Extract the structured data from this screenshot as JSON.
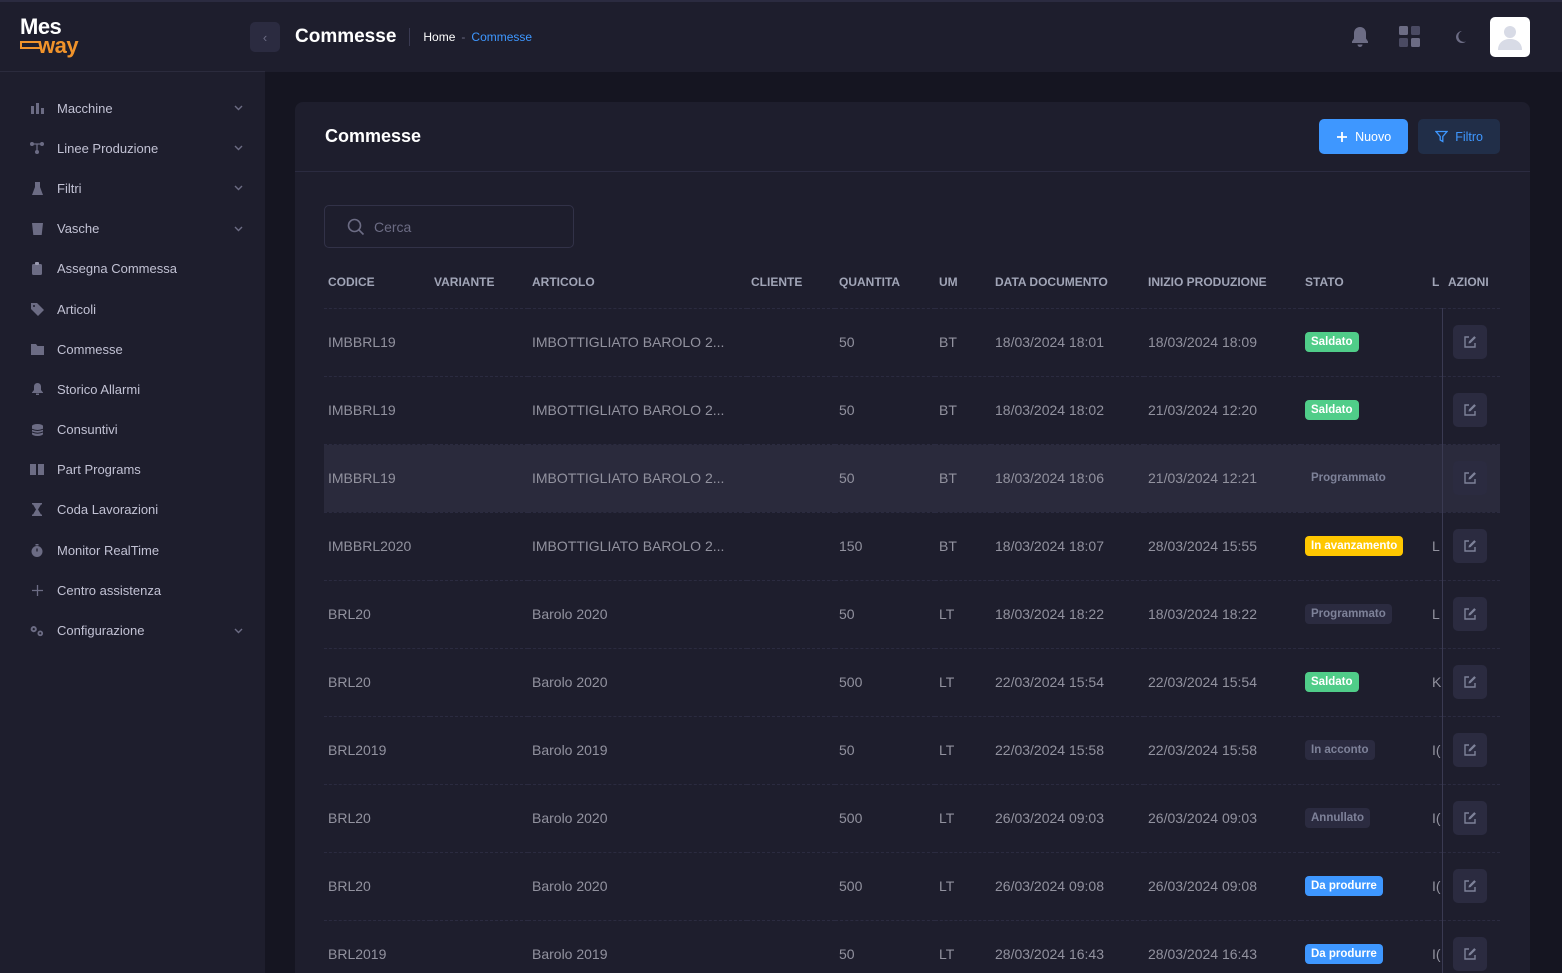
{
  "app": {
    "logo_top": "Mes",
    "logo_bottom": "way"
  },
  "sidebar": {
    "items": [
      {
        "label": "Macchine",
        "icon": "bar-chart-icon",
        "has_submenu": true
      },
      {
        "label": "Linee Produzione",
        "icon": "network-icon",
        "has_submenu": true
      },
      {
        "label": "Filtri",
        "icon": "flask-icon",
        "has_submenu": true
      },
      {
        "label": "Vasche",
        "icon": "bucket-icon",
        "has_submenu": true
      },
      {
        "label": "Assegna Commessa",
        "icon": "clipboard-icon",
        "has_submenu": false
      },
      {
        "label": "Articoli",
        "icon": "tag-icon",
        "has_submenu": false
      },
      {
        "label": "Commesse",
        "icon": "folder-icon",
        "has_submenu": false
      },
      {
        "label": "Storico Allarmi",
        "icon": "bell-icon",
        "has_submenu": false
      },
      {
        "label": "Consuntivi",
        "icon": "database-icon",
        "has_submenu": false
      },
      {
        "label": "Part Programs",
        "icon": "book-icon",
        "has_submenu": false
      },
      {
        "label": "Coda Lavorazioni",
        "icon": "hourglass-icon",
        "has_submenu": false
      },
      {
        "label": "Monitor RealTime",
        "icon": "stopwatch-icon",
        "has_submenu": false
      },
      {
        "label": "Centro assistenza",
        "icon": "plus-icon",
        "has_submenu": false
      },
      {
        "label": "Configurazione",
        "icon": "gears-icon",
        "has_submenu": true
      }
    ]
  },
  "header": {
    "title": "Commesse",
    "breadcrumb_home": "Home",
    "breadcrumb_separator": "-",
    "breadcrumb_current": "Commesse"
  },
  "card": {
    "title": "Commesse",
    "new_label": "Nuovo",
    "filter_label": "Filtro"
  },
  "search": {
    "placeholder": "Cerca"
  },
  "table": {
    "columns": [
      "CODICE",
      "VARIANTE",
      "ARTICOLO",
      "CLIENTE",
      "QUANTITA",
      "UM",
      "DATA DOCUMENTO",
      "INIZIO PRODUZIONE",
      "STATO",
      "L",
      "AZIONI"
    ],
    "rows": [
      {
        "codice": "IMBBRL19",
        "variante": "",
        "articolo": "IMBOTTIGLIATO BAROLO 2...",
        "cliente": "",
        "quantita": "50",
        "um": "BT",
        "data_documento": "18/03/2024 18:01",
        "inizio_produzione": "18/03/2024 18:09",
        "stato": "Saldato",
        "stato_color": "#50cd89",
        "l": ""
      },
      {
        "codice": "IMBBRL19",
        "variante": "",
        "articolo": "IMBOTTIGLIATO BAROLO 2...",
        "cliente": "",
        "quantita": "50",
        "um": "BT",
        "data_documento": "18/03/2024 18:02",
        "inizio_produzione": "21/03/2024 12:20",
        "stato": "Saldato",
        "stato_color": "#50cd89",
        "l": ""
      },
      {
        "codice": "IMBBRL19",
        "variante": "",
        "articolo": "IMBOTTIGLIATO BAROLO 2...",
        "cliente": "",
        "quantita": "50",
        "um": "BT",
        "data_documento": "18/03/2024 18:06",
        "inizio_produzione": "21/03/2024 12:21",
        "stato": "Programmato",
        "stato_color": "#2b2b40",
        "l": "",
        "highlight": true
      },
      {
        "codice": "IMBBRL2020",
        "variante": "",
        "articolo": "IMBOTTIGLIATO BAROLO 2...",
        "cliente": "",
        "quantita": "150",
        "um": "BT",
        "data_documento": "18/03/2024 18:07",
        "inizio_produzione": "28/03/2024 15:55",
        "stato": "In avanzamento",
        "stato_color": "#ffc700",
        "l": "L"
      },
      {
        "codice": "BRL20",
        "variante": "",
        "articolo": "Barolo 2020",
        "cliente": "",
        "quantita": "50",
        "um": "LT",
        "data_documento": "18/03/2024 18:22",
        "inizio_produzione": "18/03/2024 18:22",
        "stato": "Programmato",
        "stato_color": "#2b2b40",
        "l": "L"
      },
      {
        "codice": "BRL20",
        "variante": "",
        "articolo": "Barolo 2020",
        "cliente": "",
        "quantita": "500",
        "um": "LT",
        "data_documento": "22/03/2024 15:54",
        "inizio_produzione": "22/03/2024 15:54",
        "stato": "Saldato",
        "stato_color": "#50cd89",
        "l": "K"
      },
      {
        "codice": "BRL2019",
        "variante": "",
        "articolo": "Barolo 2019",
        "cliente": "",
        "quantita": "50",
        "um": "LT",
        "data_documento": "22/03/2024 15:58",
        "inizio_produzione": "22/03/2024 15:58",
        "stato": "In acconto",
        "stato_color": "#2b2b40",
        "l": "I("
      },
      {
        "codice": "BRL20",
        "variante": "",
        "articolo": "Barolo 2020",
        "cliente": "",
        "quantita": "500",
        "um": "LT",
        "data_documento": "26/03/2024 09:03",
        "inizio_produzione": "26/03/2024 09:03",
        "stato": "Annullato",
        "stato_color": "#2b2b40",
        "l": "I("
      },
      {
        "codice": "BRL20",
        "variante": "",
        "articolo": "Barolo 2020",
        "cliente": "",
        "quantita": "500",
        "um": "LT",
        "data_documento": "26/03/2024 09:08",
        "inizio_produzione": "26/03/2024 09:08",
        "stato": "Da produrre",
        "stato_color": "#3e97ff",
        "l": "I("
      },
      {
        "codice": "BRL2019",
        "variante": "",
        "articolo": "Barolo 2019",
        "cliente": "",
        "quantita": "50",
        "um": "LT",
        "data_documento": "28/03/2024 16:43",
        "inizio_produzione": "28/03/2024 16:43",
        "stato": "Da produrre",
        "stato_color": "#3e97ff",
        "l": "I("
      }
    ]
  },
  "colors": {
    "accent": "#3e97ff",
    "background": "#151521",
    "panel": "#1e1e2d",
    "success": "#50cd89",
    "warning": "#ffc700"
  }
}
